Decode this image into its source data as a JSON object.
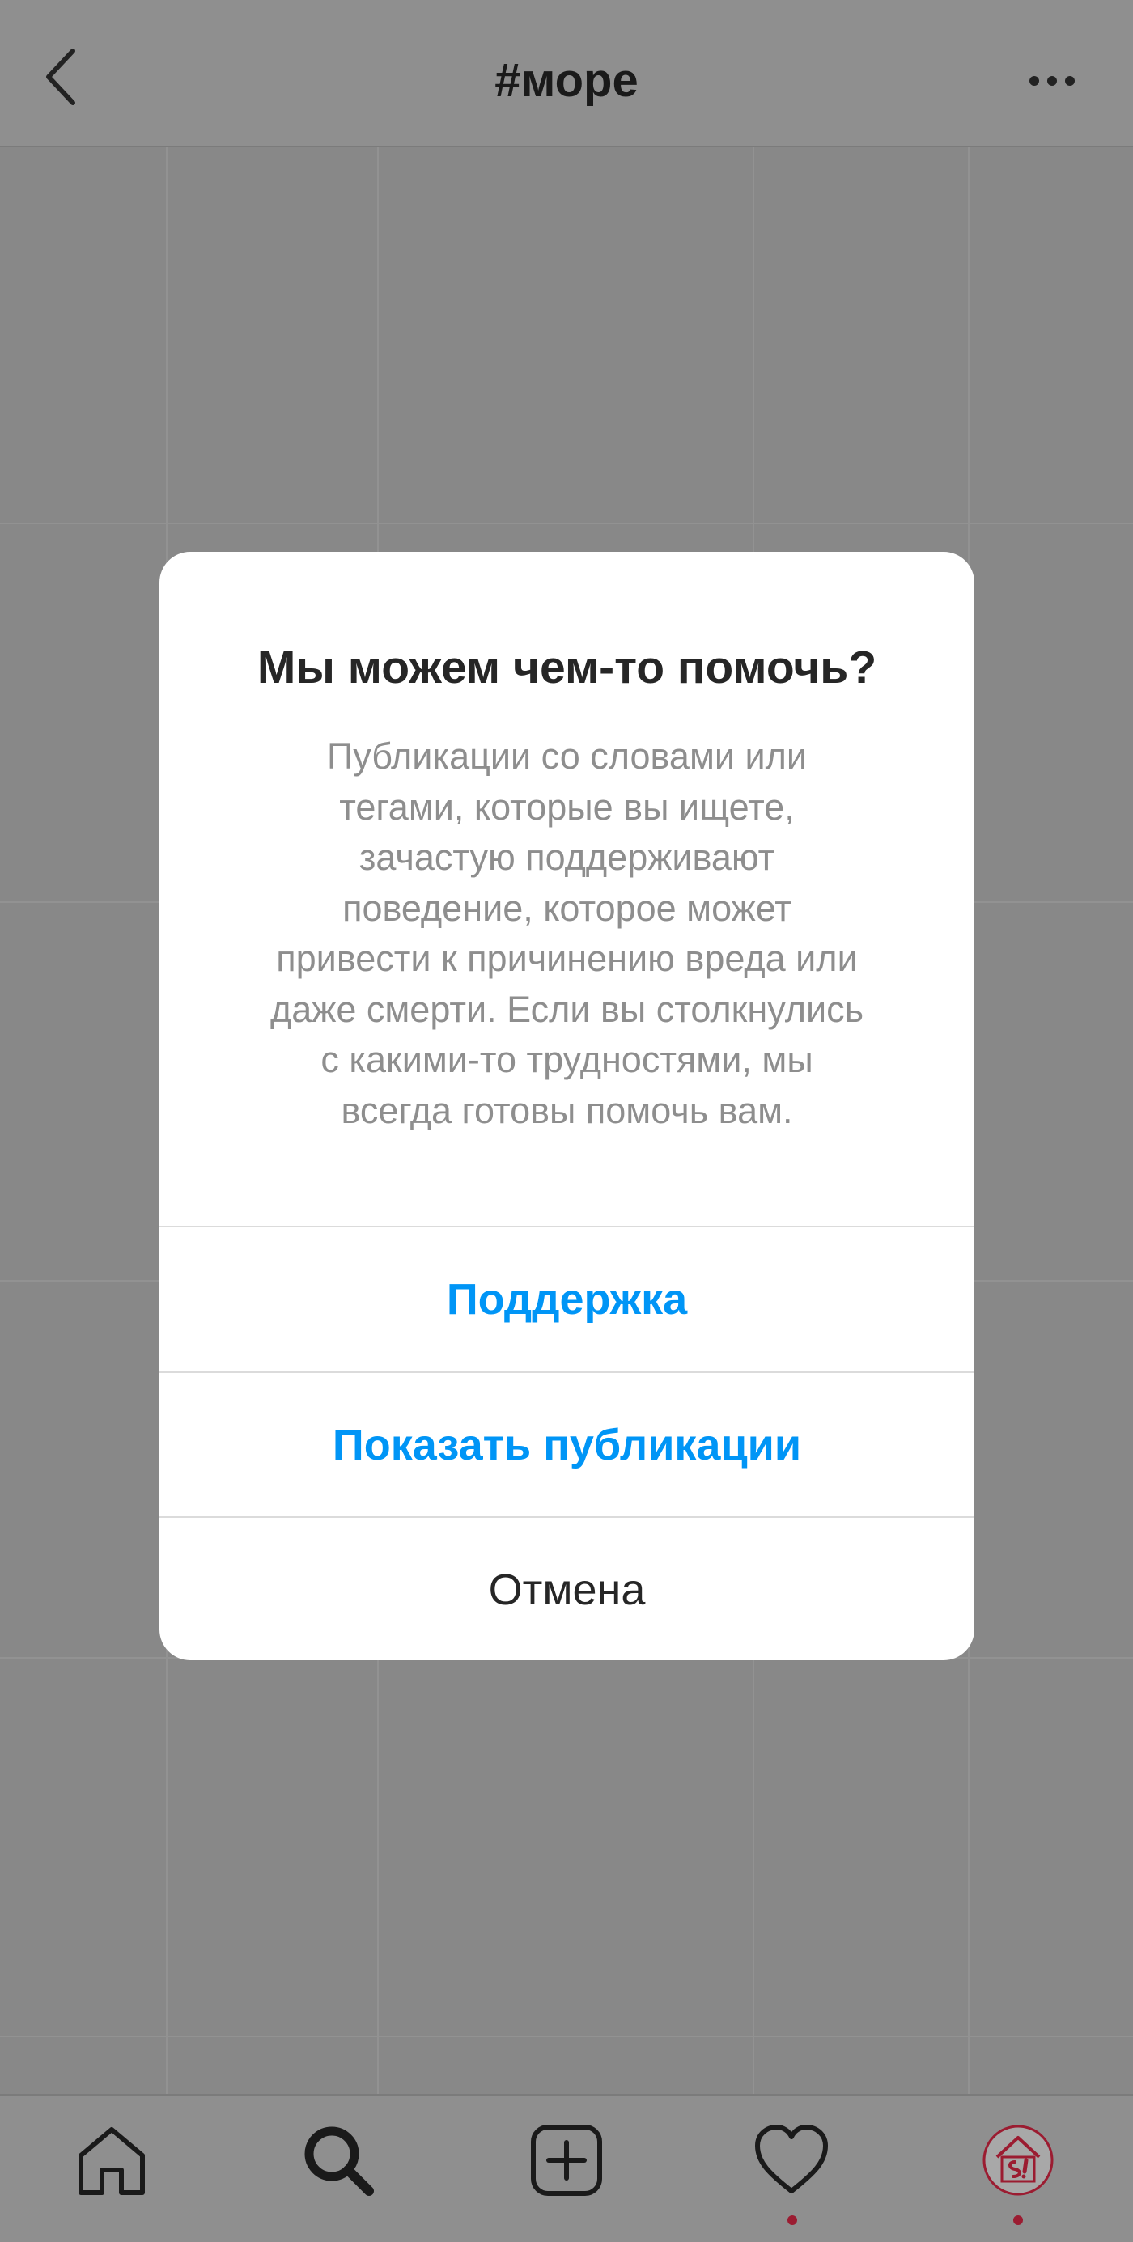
{
  "header": {
    "title": "#море",
    "back_icon": "chevron-left-icon",
    "more_icon": "more-horizontal-icon"
  },
  "dialog": {
    "title": "Мы можем чем-то помочь?",
    "message_lines": [
      "Публикации со словами или",
      "тегами, которые вы ищете,",
      "зачастую поддерживают",
      "поведение, которое может",
      "привести к причинению вреда или",
      "даже смерти. Если вы столкнулись",
      "с какими-то трудностями, мы",
      "всегда готовы помочь вам."
    ],
    "buttons": {
      "support": "Поддержка",
      "show_posts": "Показать публикации",
      "cancel": "Отмена"
    }
  },
  "tabbar": {
    "items": [
      {
        "icon": "home-icon",
        "active": false,
        "notification": false
      },
      {
        "icon": "search-icon",
        "active": true,
        "notification": false
      },
      {
        "icon": "new-post-icon",
        "active": false,
        "notification": false
      },
      {
        "icon": "heart-icon",
        "active": false,
        "notification": true
      },
      {
        "icon": "profile-avatar-icon",
        "active": false,
        "notification": true
      }
    ]
  },
  "colors": {
    "accent": "#0095f6",
    "text_primary": "#262626",
    "text_secondary": "#8e8e8e",
    "notification_dot": "#9b1c31",
    "overlay": "#8e8e8e"
  }
}
